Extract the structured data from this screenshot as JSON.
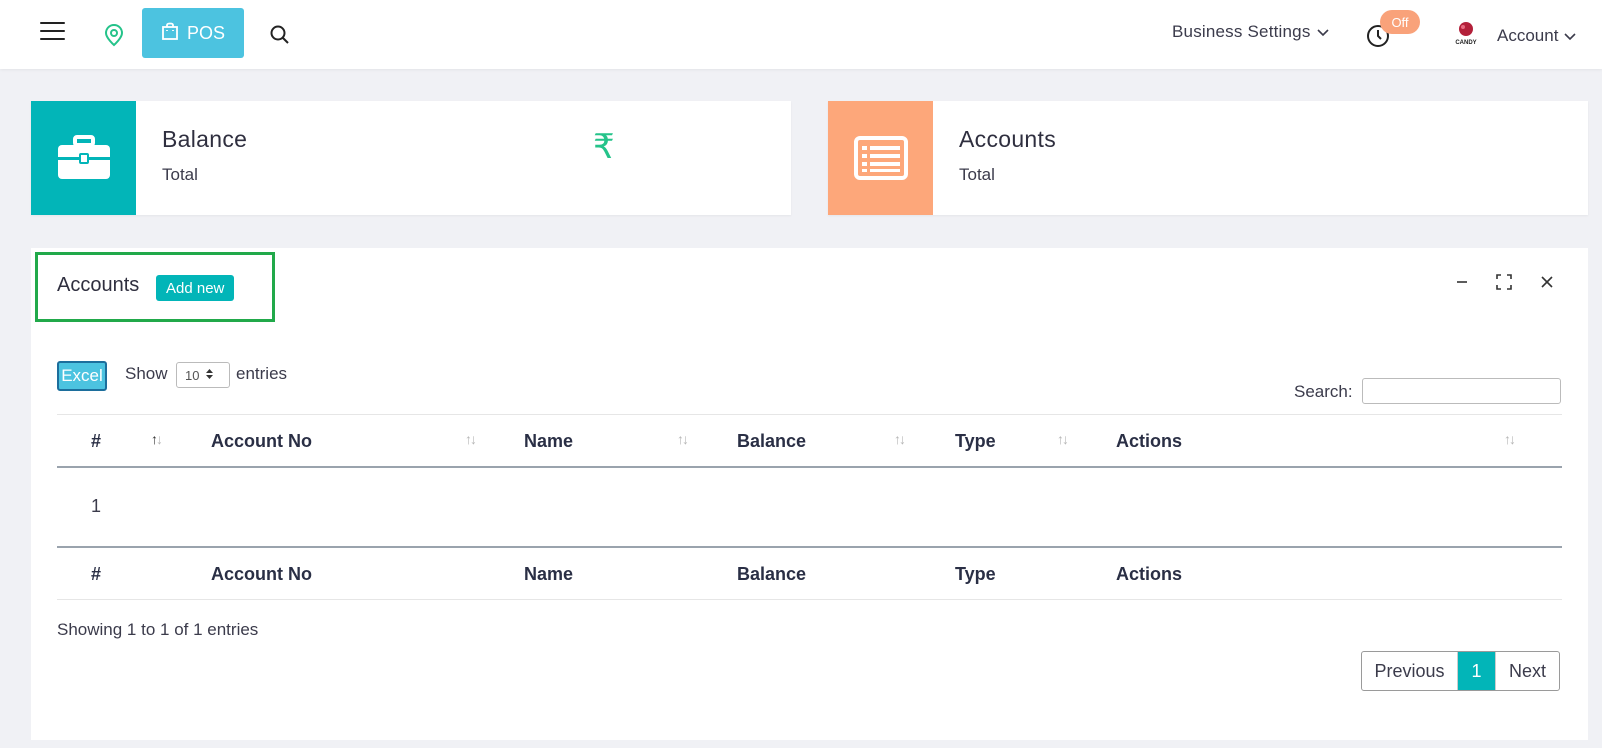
{
  "header": {
    "pos_label": "POS",
    "business_settings_label": "Business Settings",
    "clock_badge": "Off",
    "logo_text": "CANDY",
    "account_label": "Account"
  },
  "cards": [
    {
      "title": "Balance",
      "subtitle": "Total",
      "currency_symbol": "₹",
      "icon": "briefcase-icon",
      "color": "#02b5b8"
    },
    {
      "title": "Accounts",
      "subtitle": "Total",
      "icon": "list-icon",
      "color": "#fda77a"
    }
  ],
  "panel": {
    "title": "Accounts",
    "add_new_label": "Add new",
    "excel_label": "Excel",
    "show_label": "Show",
    "page_length": "10",
    "entries_label": "entries",
    "search_label": "Search:",
    "search_value": "",
    "columns": [
      "#",
      "Account No",
      "Name",
      "Balance",
      "Type",
      "Actions"
    ],
    "rows": [
      {
        "index": "1",
        "account_no": "",
        "name": "",
        "balance": "",
        "type": "",
        "actions": ""
      }
    ],
    "info_text": "Showing 1 to 1 of 1 entries",
    "pagination": {
      "previous": "Previous",
      "current": "1",
      "next": "Next"
    }
  },
  "colors": {
    "teal": "#02b5b8",
    "orange": "#fda77a",
    "sky": "#4cc3e0",
    "highlight": "#21a94a"
  }
}
